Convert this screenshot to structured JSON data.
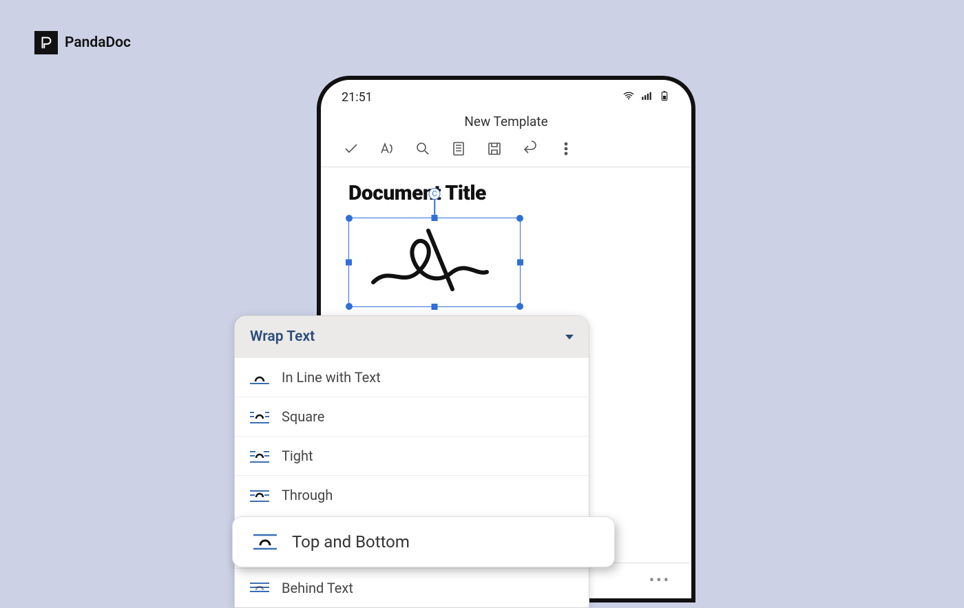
{
  "brand": {
    "name": "PandaDoc"
  },
  "status": {
    "time": "21:51"
  },
  "header": {
    "title": "New Template"
  },
  "document": {
    "title": "Document Title"
  },
  "rotate": {
    "label": "C"
  },
  "menu": {
    "title": "Wrap Text",
    "items": [
      {
        "label": "In Line with Text"
      },
      {
        "label": "Square"
      },
      {
        "label": "Tight"
      },
      {
        "label": "Through"
      },
      {
        "label": "Top and Bottom"
      },
      {
        "label": "Behind Text"
      }
    ]
  },
  "more": {
    "dots": "•••"
  }
}
